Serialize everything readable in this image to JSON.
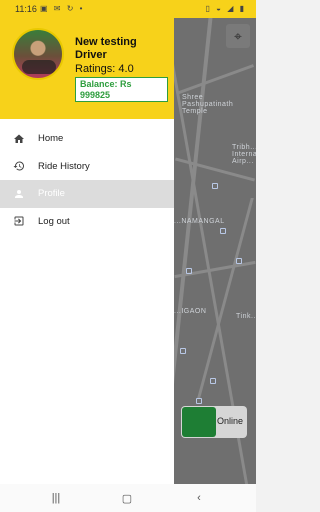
{
  "status_bar": {
    "time": "11:16",
    "left_icons": [
      "image-icon",
      "mail-icon",
      "sync-icon",
      "dot-icon"
    ],
    "right_icons": [
      "vibrate-icon",
      "wifi-icon",
      "signal-icon",
      "battery-icon"
    ]
  },
  "profile": {
    "name": "New testing Driver",
    "ratings": "Ratings: 4.0",
    "balance": "Balance: Rs 999825"
  },
  "menu": {
    "items": [
      {
        "label": "Home",
        "icon": "home-icon",
        "active": false
      },
      {
        "label": "Ride History",
        "icon": "history-icon",
        "active": false
      },
      {
        "label": "Profile",
        "icon": "person-icon",
        "active": true
      },
      {
        "label": "Log out",
        "icon": "logout-icon",
        "active": false
      }
    ]
  },
  "map": {
    "labels": [
      "Shree Pashupatinath Temple",
      "Tribh... Interna... Airp...",
      "...NAMANGAL",
      "...IGAON",
      "Tink..."
    ]
  },
  "online_toggle": {
    "label": "Online",
    "state": "on"
  },
  "nav_bar": {
    "buttons": [
      "recent-apps-icon",
      "home-circle-icon",
      "back-icon"
    ]
  },
  "colors": {
    "header": "#f7d21a",
    "accent_green": "#2e9e3e",
    "active_item": "#dcdcdc"
  }
}
